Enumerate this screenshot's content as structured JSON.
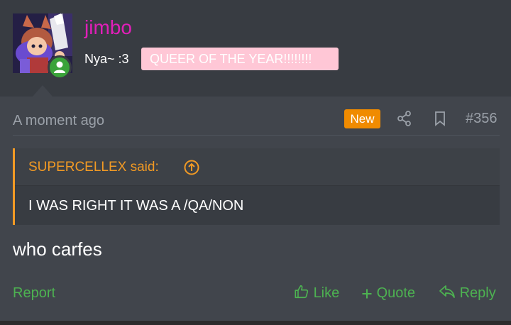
{
  "user": {
    "name": "jimbo",
    "title": "Nya~ :3",
    "banner": "QUEER OF THE YEAR!!!!!!!!",
    "avatar_icon": "avatar",
    "status_icon": "user-online-icon"
  },
  "post": {
    "timestamp": "A moment ago",
    "new_badge": "New",
    "number": "#356",
    "quote": {
      "author": "SUPERCELLEX said:",
      "body": "I WAS RIGHT IT WAS A /QA/NON"
    },
    "message": "who carfes"
  },
  "actions": {
    "report": "Report",
    "like": "Like",
    "quote": "Quote",
    "reply": "Reply"
  },
  "colors": {
    "username": "#e11fb9",
    "accent_orange": "#f29a24",
    "action_green": "#4db251",
    "banner_bg": "#ffc7d6",
    "new_badge_bg": "#f08b00"
  }
}
